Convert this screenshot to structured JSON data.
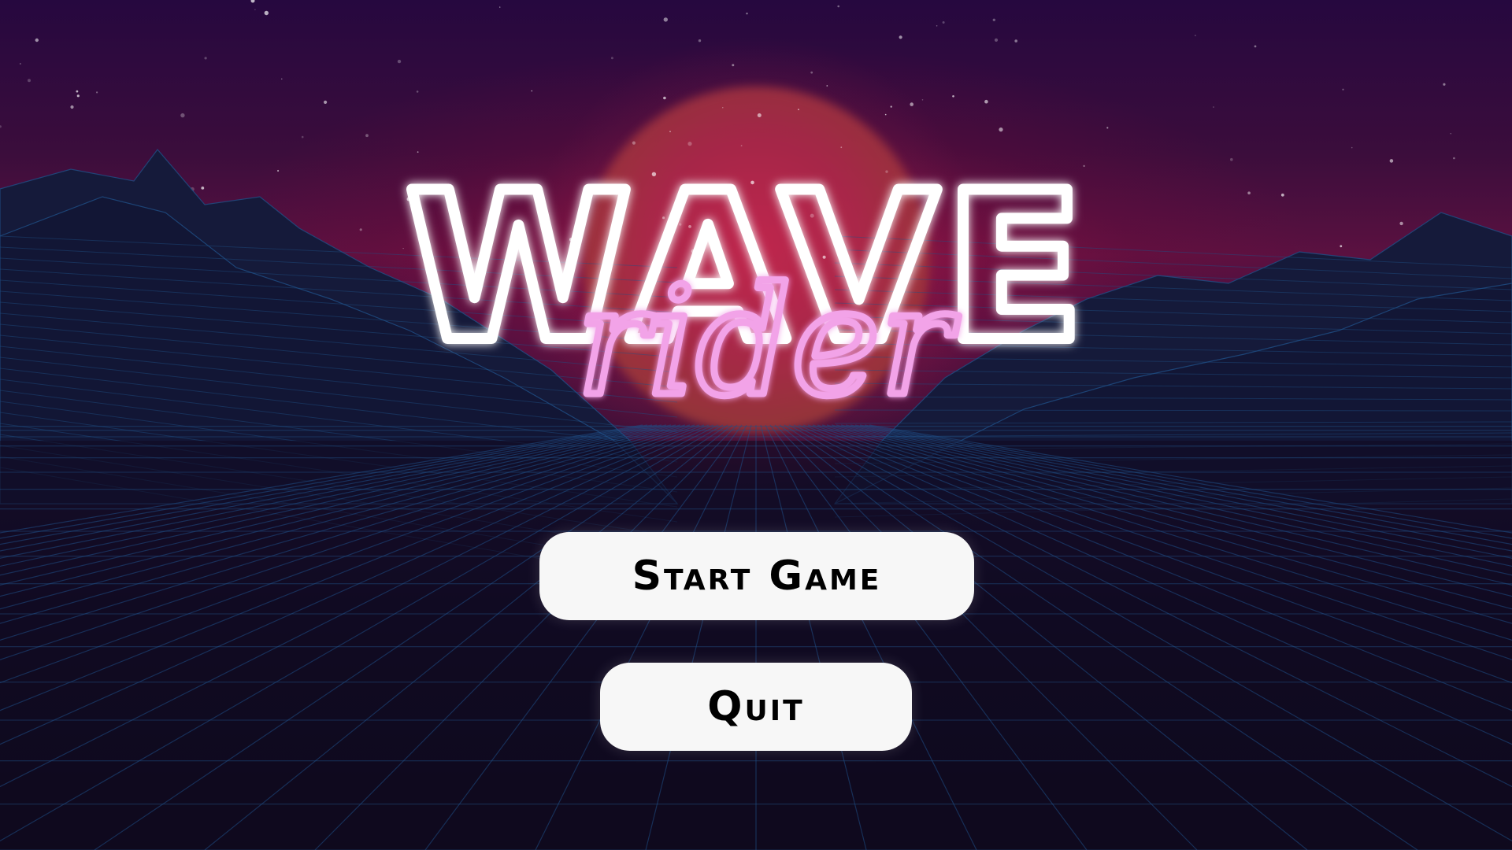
{
  "title": {
    "main": "WAVE",
    "script": "rider"
  },
  "menu": {
    "start_label": "Start Game",
    "quit_label": "Quit"
  },
  "colors": {
    "neon_white": "#ffffff",
    "neon_pink": "#f2a3e8",
    "grid_line": "#1f4f86",
    "button_bg": "#f7f7f7",
    "button_text": "#000000"
  }
}
